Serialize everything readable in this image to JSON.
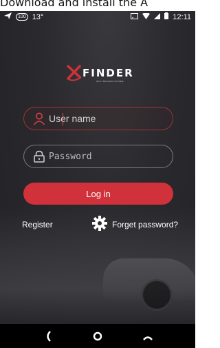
{
  "caption": "Download and install the A",
  "status_bar": {
    "badge": "100",
    "temperature": "13°",
    "time": "12:11"
  },
  "logo": {
    "text": "FINDER",
    "tagline": "GPS TRACKING SYSTEM"
  },
  "login_form": {
    "username_placeholder": "User name",
    "password_placeholder": "Password",
    "login_label": "Log in"
  },
  "links": {
    "register": "Register",
    "forget_password": "Forget password?"
  },
  "colors": {
    "accent": "#d0313a",
    "background": "#2a2a2e"
  },
  "icons": [
    "user-icon",
    "lock-icon",
    "gear-icon",
    "back-icon",
    "home-icon",
    "recents-icon"
  ]
}
